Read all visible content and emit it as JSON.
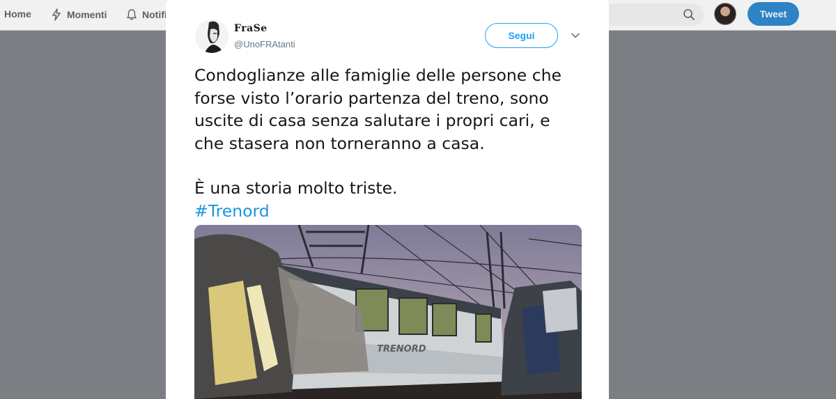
{
  "nav": {
    "home": "Home",
    "moments": "Momenti",
    "notifications": "Notifi"
  },
  "topbar": {
    "tweet_button": "Tweet"
  },
  "tweet": {
    "display_name": "FraSe",
    "username": "@UnoFRAtanti",
    "follow_label": "Segui",
    "lines": [
      "Condoglianze alle famiglie delle persone che",
      "forse visto l’orario partenza del treno, sono",
      "uscite di casa senza salutare i propri cari, e",
      "che stasera non torneranno a casa."
    ],
    "second_paragraph": "È una storia molto triste.",
    "hashtag": "#Trenord"
  },
  "media": {
    "train_logo_text": "TRENORD"
  },
  "colors": {
    "accent": "#1da1f2",
    "hashtag": "#1b95e0",
    "overlay": "#7b7f83",
    "tweet_button": "#2d83c4"
  },
  "icons": {
    "moments": "lightning-icon",
    "notifications": "bell-icon",
    "search": "search-icon",
    "caret": "chevron-down-icon"
  }
}
